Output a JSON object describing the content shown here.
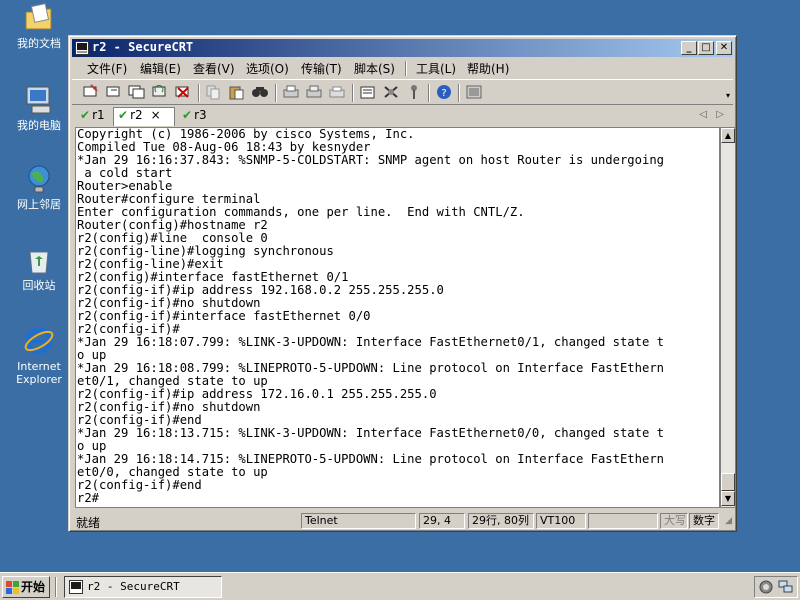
{
  "desktop": {
    "icons": [
      {
        "label": "我的文档"
      },
      {
        "label": "我的电脑"
      },
      {
        "label": "网上邻居"
      },
      {
        "label": "回收站"
      },
      {
        "label": "Internet\nExplorer"
      }
    ]
  },
  "window": {
    "title": "r2 - SecureCRT",
    "menu": [
      "文件(F)",
      "编辑(E)",
      "查看(V)",
      "选项(O)",
      "传输(T)",
      "脚本(S)",
      "工具(L)",
      "帮助(H)"
    ],
    "tabs": [
      {
        "label": "r1"
      },
      {
        "label": "r2"
      },
      {
        "label": "r3"
      }
    ],
    "tab_close": "×",
    "terminal_lines": [
      "Copyright (c) 1986-2006 by cisco Systems, Inc.",
      "Compiled Tue 08-Aug-06 18:43 by kesnyder",
      "*Jan 29 16:16:37.843: %SNMP-5-COLDSTART: SNMP agent on host Router is undergoing",
      " a cold start",
      "Router>enable",
      "Router#configure terminal",
      "Enter configuration commands, one per line.  End with CNTL/Z.",
      "Router(config)#hostname r2",
      "r2(config)#line  console 0",
      "r2(config-line)#logging synchronous",
      "r2(config-line)#exit",
      "r2(config)#interface fastEthernet 0/1",
      "r2(config-if)#ip address 192.168.0.2 255.255.255.0",
      "r2(config-if)#no shutdown",
      "r2(config-if)#interface fastEthernet 0/0",
      "r2(config-if)#",
      "*Jan 29 16:18:07.799: %LINK-3-UPDOWN: Interface FastEthernet0/1, changed state t",
      "o up",
      "*Jan 29 16:18:08.799: %LINEPROTO-5-UPDOWN: Line protocol on Interface FastEthern",
      "et0/1, changed state to up",
      "r2(config-if)#ip address 172.16.0.1 255.255.255.0",
      "r2(config-if)#no shutdown",
      "r2(config-if)#end",
      "*Jan 29 16:18:13.715: %LINK-3-UPDOWN: Interface FastEthernet0/0, changed state t",
      "o up",
      "*Jan 29 16:18:14.715: %LINEPROTO-5-UPDOWN: Line protocol on Interface FastEthern",
      "et0/0, changed state to up",
      "r2(config-if)#end",
      "r2#"
    ],
    "status": {
      "ready": "就绪",
      "protocol": "Telnet",
      "cursor": "29,  4",
      "size": "29行, 80列",
      "emulation": "VT100",
      "caps": "大写",
      "num": "数字"
    }
  },
  "taskbar": {
    "start_label": "开始",
    "task_label": "r2 - SecureCRT"
  },
  "colors": {
    "desktop": "#3a6ea5",
    "titlebar_start": "#0a246a",
    "titlebar_end": "#a6caf0",
    "chrome": "#d4d0c8"
  }
}
